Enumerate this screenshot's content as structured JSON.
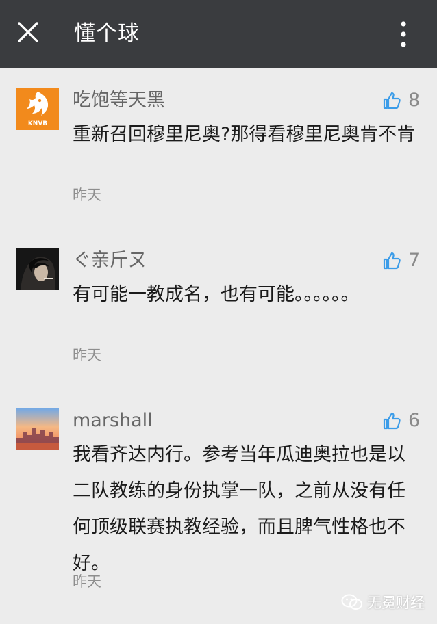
{
  "header": {
    "title": "懂个球"
  },
  "comments": [
    {
      "username": "吃饱等天黑",
      "likes": "8",
      "text": "重新召回穆里尼奥?那得看穆里尼奥肯不肯",
      "time": "昨天",
      "avatar": "knvb-lion-logo",
      "avatar_label": "KNVB"
    },
    {
      "username": "ぐ亲斤ㄡ",
      "likes": "7",
      "text": "有可能一教成名，也有可能。。。。。。",
      "time": "昨天",
      "avatar": "dark-portrait-photo"
    },
    {
      "username": "marshall",
      "likes": "6",
      "text": "我看齐达内行。参考当年瓜迪奥拉也是以二队教练的身份执掌一队，之前从没有任何顶级联赛执教经验，而且脾气性格也不好。",
      "time": "昨天",
      "avatar": "sunset-skyline-photo"
    }
  ],
  "watermark": {
    "text": "无冕财经",
    "icon": "wechat-logo-icon"
  },
  "colors": {
    "topbar": "#3a3c3f",
    "background": "#ececec",
    "like_icon": "#3b9ce8",
    "knvb_orange": "#f28a1c"
  }
}
